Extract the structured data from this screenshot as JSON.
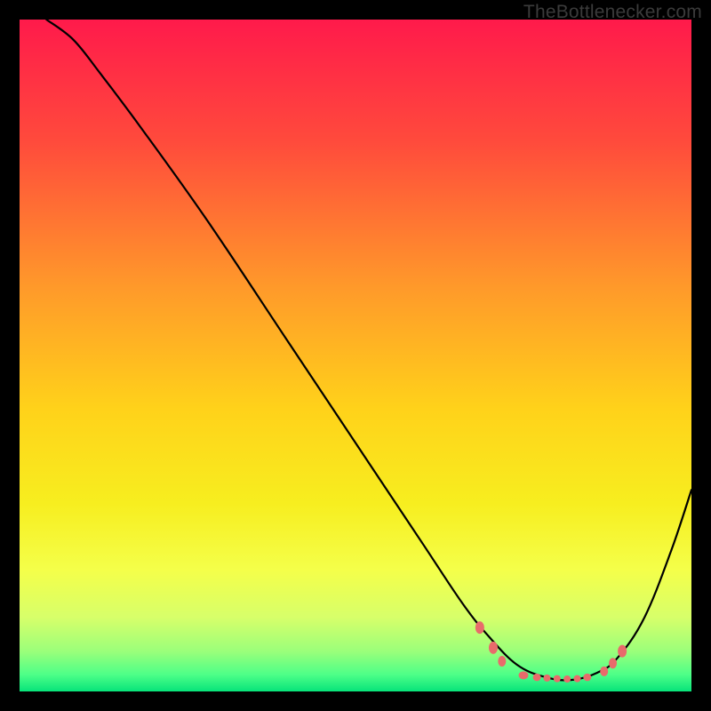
{
  "watermark": "TheBottlenecker.com",
  "chart_data": {
    "type": "line",
    "title": "",
    "xlabel": "",
    "ylabel": "",
    "xlim": [
      0,
      100
    ],
    "ylim": [
      0,
      100
    ],
    "gradient_stops": [
      {
        "offset": 0,
        "color": "#ff1a4b"
      },
      {
        "offset": 0.18,
        "color": "#ff4a3c"
      },
      {
        "offset": 0.4,
        "color": "#ff9a2a"
      },
      {
        "offset": 0.58,
        "color": "#ffd21a"
      },
      {
        "offset": 0.72,
        "color": "#f7ee1f"
      },
      {
        "offset": 0.82,
        "color": "#f4ff4a"
      },
      {
        "offset": 0.89,
        "color": "#d7ff6a"
      },
      {
        "offset": 0.94,
        "color": "#9bff7a"
      },
      {
        "offset": 0.975,
        "color": "#4dff88"
      },
      {
        "offset": 1.0,
        "color": "#07e37a"
      }
    ],
    "series": [
      {
        "name": "curve",
        "color": "#000000",
        "stroke_width": 2.2,
        "points": [
          {
            "x": 4,
            "y": 100
          },
          {
            "x": 8,
            "y": 97
          },
          {
            "x": 12,
            "y": 92
          },
          {
            "x": 18,
            "y": 84
          },
          {
            "x": 28,
            "y": 70
          },
          {
            "x": 40,
            "y": 52
          },
          {
            "x": 52,
            "y": 34
          },
          {
            "x": 60,
            "y": 22
          },
          {
            "x": 66,
            "y": 13
          },
          {
            "x": 70,
            "y": 8
          },
          {
            "x": 74,
            "y": 4
          },
          {
            "x": 78,
            "y": 2.2
          },
          {
            "x": 82,
            "y": 1.7
          },
          {
            "x": 86,
            "y": 2.8
          },
          {
            "x": 89,
            "y": 5
          },
          {
            "x": 93,
            "y": 11
          },
          {
            "x": 97,
            "y": 21
          },
          {
            "x": 100,
            "y": 30
          }
        ]
      }
    ],
    "markers": {
      "color": "#e86b6b",
      "clusters": [
        {
          "points": [
            {
              "x": 68.5,
              "y": 9.5,
              "rx": 5,
              "ry": 7
            },
            {
              "x": 70.5,
              "y": 6.5,
              "rx": 5,
              "ry": 7
            },
            {
              "x": 71.8,
              "y": 4.5,
              "rx": 4.5,
              "ry": 6
            }
          ]
        },
        {
          "points": [
            {
              "x": 75,
              "y": 2.4,
              "rx": 5.5,
              "ry": 4.5
            },
            {
              "x": 77,
              "y": 2.1,
              "rx": 4.5,
              "ry": 4.2
            },
            {
              "x": 78.5,
              "y": 2.0,
              "rx": 4,
              "ry": 4
            },
            {
              "x": 80,
              "y": 1.9,
              "rx": 4,
              "ry": 4
            },
            {
              "x": 81.5,
              "y": 1.85,
              "rx": 4,
              "ry": 4
            },
            {
              "x": 83,
              "y": 1.9,
              "rx": 4,
              "ry": 4
            },
            {
              "x": 84.5,
              "y": 2.1,
              "rx": 4.5,
              "ry": 4.2
            }
          ]
        },
        {
          "points": [
            {
              "x": 87,
              "y": 3.0,
              "rx": 4.5,
              "ry": 5.5
            },
            {
              "x": 88.3,
              "y": 4.2,
              "rx": 4.5,
              "ry": 6
            },
            {
              "x": 89.7,
              "y": 6.0,
              "rx": 5,
              "ry": 7
            }
          ]
        }
      ]
    }
  }
}
